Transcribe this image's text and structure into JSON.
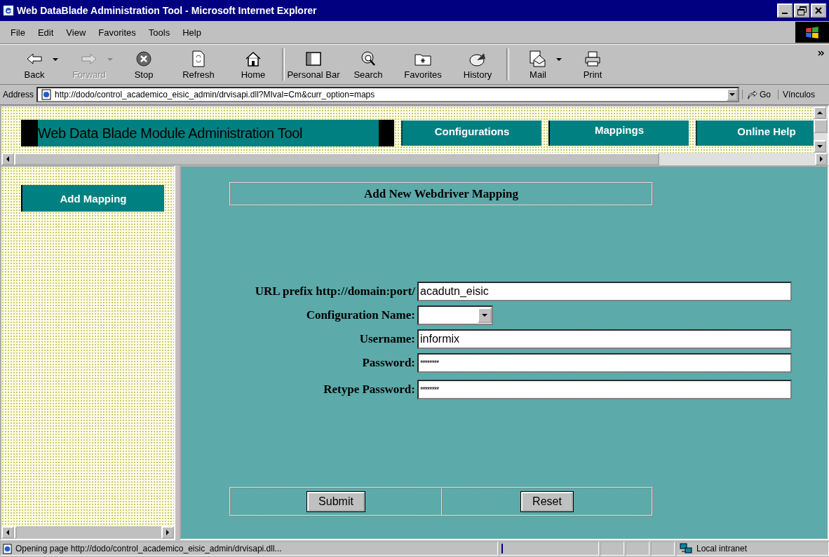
{
  "window": {
    "title": "Web DataBlade Administration Tool - Microsoft Internet Explorer"
  },
  "menu": [
    "File",
    "Edit",
    "View",
    "Favorites",
    "Tools",
    "Help"
  ],
  "toolbar": [
    {
      "kind": "back",
      "label": "Back",
      "disabled": false,
      "dropdown": true
    },
    {
      "kind": "forward",
      "label": "Forward",
      "disabled": true,
      "dropdown": true
    },
    {
      "kind": "stop",
      "label": "Stop",
      "disabled": false,
      "dropdown": false
    },
    {
      "kind": "refresh",
      "label": "Refresh",
      "disabled": false,
      "dropdown": false
    },
    {
      "kind": "home",
      "label": "Home",
      "disabled": false,
      "dropdown": false
    },
    {
      "kind": "personal-bar",
      "label": "Personal Bar",
      "disabled": false,
      "dropdown": false
    },
    {
      "kind": "search",
      "label": "Search",
      "disabled": false,
      "dropdown": false
    },
    {
      "kind": "favorites",
      "label": "Favorites",
      "disabled": false,
      "dropdown": false
    },
    {
      "kind": "history",
      "label": "History",
      "disabled": false,
      "dropdown": false
    },
    {
      "kind": "mail",
      "label": "Mail",
      "disabled": false,
      "dropdown": true
    },
    {
      "kind": "print",
      "label": "Print",
      "disabled": false,
      "dropdown": false
    }
  ],
  "address_bar": {
    "label": "Address",
    "value": "http://dodo/control_academico_eisic_admin/drvisapi.dll?MIval=Cm&curr_option=maps",
    "go": "Go",
    "links": "Vínculos"
  },
  "banner": {
    "title": "Web Data Blade Module Administration Tool",
    "tabs": [
      {
        "label": "Configurations",
        "selected": false
      },
      {
        "label": "Mappings",
        "selected": true
      },
      {
        "label": "Online Help",
        "selected": false
      }
    ]
  },
  "sidebar": {
    "items": [
      "Add Mapping"
    ]
  },
  "form": {
    "heading": "Add New Webdriver Mapping",
    "fields": [
      {
        "kind": "text",
        "label": "URL prefix http://domain:port/",
        "value": "acadutn_eisic"
      },
      {
        "kind": "select",
        "label": "Configuration Name:"
      },
      {
        "kind": "text",
        "label": "Username:",
        "value": "informix"
      },
      {
        "kind": "password",
        "label": "Password:",
        "value": "********"
      },
      {
        "kind": "password",
        "label": "Retype Password:",
        "value": "********"
      }
    ],
    "buttons": [
      "Submit",
      "Reset"
    ]
  },
  "status_bar": {
    "text": "Opening page http://dodo/control_academico_eisic_admin/drvisapi.dll...",
    "zone": "Local intranet"
  }
}
